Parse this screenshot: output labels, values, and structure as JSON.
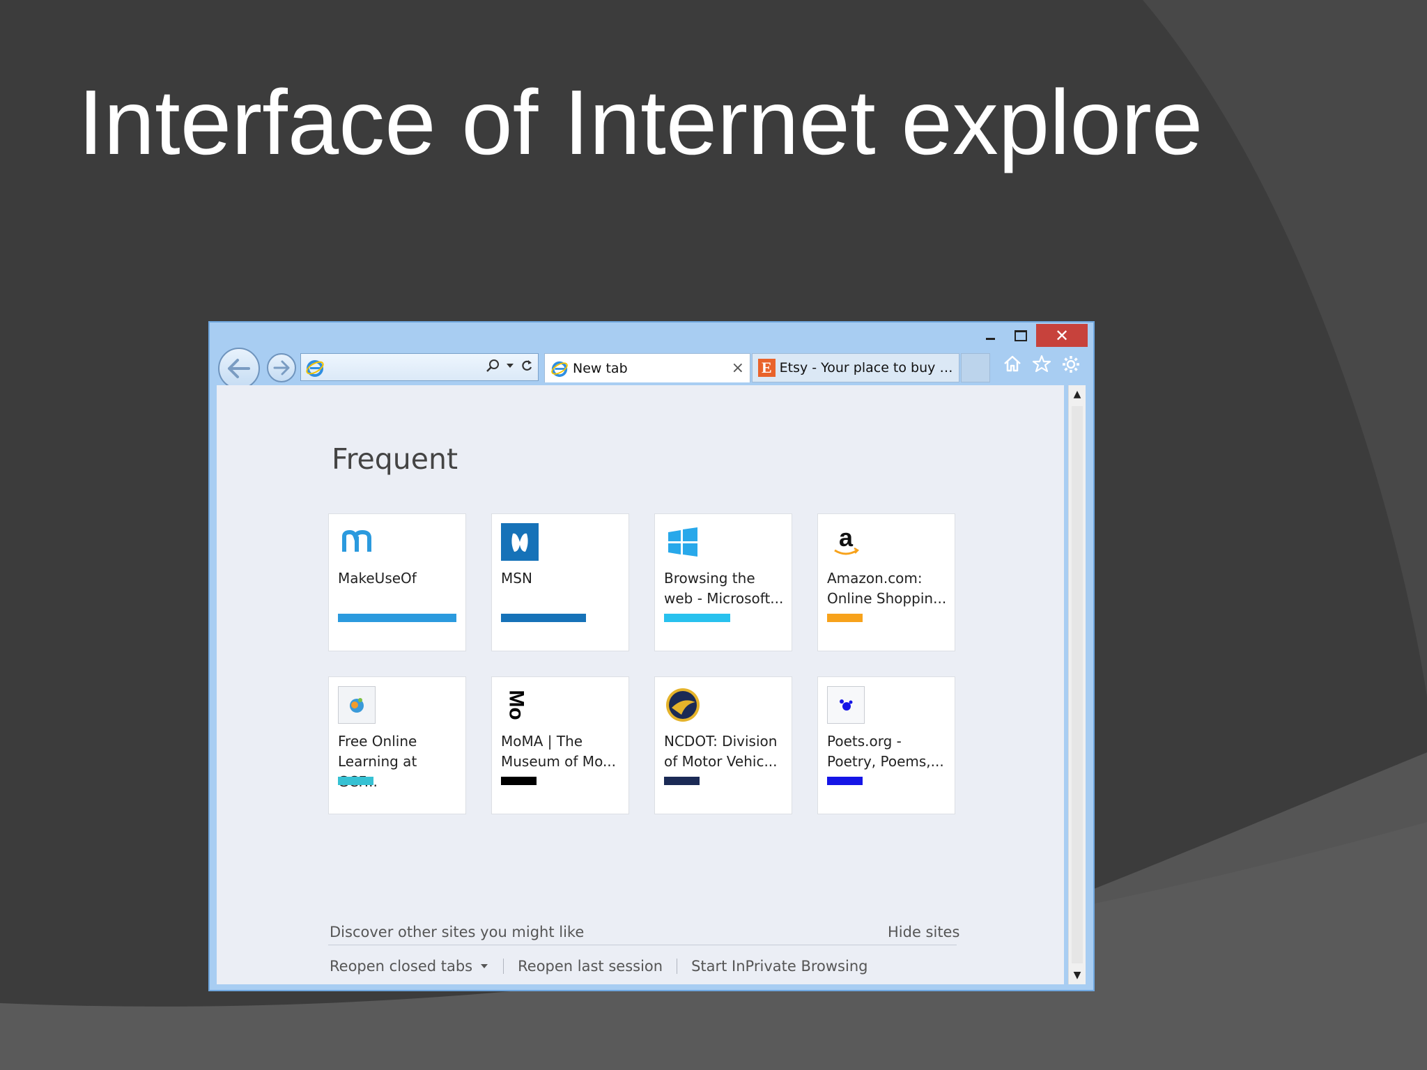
{
  "slide": {
    "title": "Interface of Internet explore"
  },
  "window": {
    "controls": {
      "minimize": "–",
      "maximize": "□",
      "close": "✕"
    }
  },
  "address_bar": {
    "value": "",
    "placeholder": ""
  },
  "tabs": [
    {
      "label": "New tab",
      "active": true,
      "close": "×"
    },
    {
      "label": "Etsy - Your place to buy an...",
      "active": false,
      "icon_letter": "E"
    }
  ],
  "toolbar": {
    "icons": [
      "home-icon",
      "favorites-star-icon",
      "settings-gear-icon"
    ]
  },
  "new_tab_page": {
    "heading": "Frequent",
    "tiles": [
      {
        "label": "MakeUseOf",
        "bar_color": "#2b9ade",
        "bar_fraction": 1.0,
        "icon": "makeuseof-icon"
      },
      {
        "label": "MSN",
        "bar_color": "#1672b8",
        "bar_fraction": 0.72,
        "icon": "msn-icon"
      },
      {
        "label": "Browsing the web - Microsoft...",
        "bar_color": "#28c1ee",
        "bar_fraction": 0.56,
        "icon": "windows-icon"
      },
      {
        "label": "Amazon.com: Online Shoppin...",
        "bar_color": "#f7a21b",
        "bar_fraction": 0.3,
        "icon": "amazon-icon"
      },
      {
        "label": "Free Online Learning at GCF...",
        "bar_color": "#36c1d3",
        "bar_fraction": 0.3,
        "icon": "gcf-icon"
      },
      {
        "label": "MoMA | The Museum of Mo...",
        "bar_color": "#000000",
        "bar_fraction": 0.3,
        "icon": "moma-icon",
        "icon_text": "Mo"
      },
      {
        "label": "NCDOT: Division of Motor Vehic...",
        "bar_color": "#1b2a55",
        "bar_fraction": 0.3,
        "icon": "ncdot-icon"
      },
      {
        "label": "Poets.org - Poetry, Poems,...",
        "bar_color": "#1515e6",
        "bar_fraction": 0.3,
        "icon": "poets-icon"
      }
    ],
    "discover": "Discover other sites you might like",
    "hide_sites": "Hide sites",
    "bottom_links": {
      "reopen_closed_tabs": "Reopen closed tabs",
      "reopen_last_session": "Reopen last session",
      "start_inprivate": "Start InPrivate Browsing"
    }
  },
  "scrollbar": {
    "up": "▲",
    "down": "▼"
  }
}
